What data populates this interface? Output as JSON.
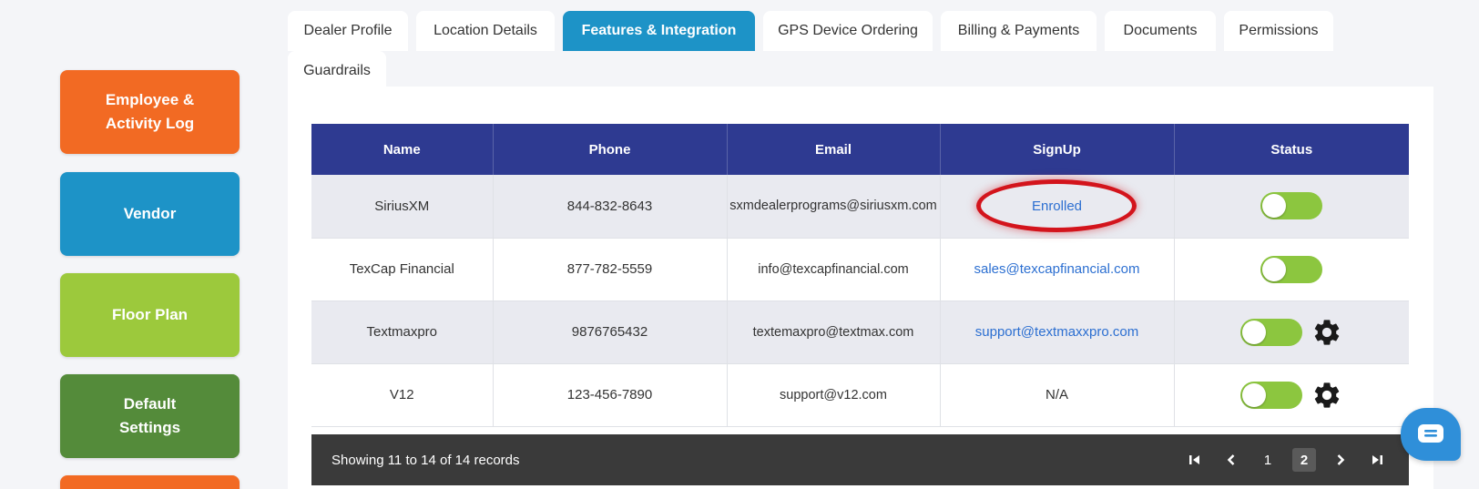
{
  "sidebar": {
    "items": [
      {
        "label": "Employee &\nActivity Log",
        "color": "#f26a23"
      },
      {
        "label": "Vendor",
        "color": "#1d93c7"
      },
      {
        "label": "Floor Plan",
        "color": "#9cc93c"
      },
      {
        "label": "Default\nSettings",
        "color": "#548b3a"
      },
      {
        "label": "",
        "color": "#f26a23"
      }
    ]
  },
  "tabs": [
    {
      "label": "Dealer Profile",
      "active": false
    },
    {
      "label": "Location Details",
      "active": false
    },
    {
      "label": "Features & Integration",
      "active": true
    },
    {
      "label": "GPS Device Ordering",
      "active": false
    },
    {
      "label": "Billing & Payments",
      "active": false
    },
    {
      "label": "Documents",
      "active": false
    },
    {
      "label": "Permissions",
      "active": false
    },
    {
      "label": "Guardrails",
      "active": false
    }
  ],
  "table": {
    "headers": [
      "Name",
      "Phone",
      "Email",
      "SignUp",
      "Status"
    ],
    "rows": [
      {
        "name": "SiriusXM",
        "phone": "844-832-8643",
        "email": "sxmdealerprograms@siriusxm.com",
        "signup": "Enrolled",
        "enabled": true,
        "gear": false
      },
      {
        "name": "TexCap Financial",
        "phone": "877-782-5559",
        "email": "info@texcapfinancial.com",
        "signup": "sales@texcapfinancial.com",
        "enabled": true,
        "gear": false
      },
      {
        "name": "Textmaxpro",
        "phone": "9876765432",
        "email": "textemaxpro@textmax.com",
        "signup": "support@textmaxxpro.com",
        "enabled": true,
        "gear": true
      },
      {
        "name": "V12",
        "phone": "123-456-7890",
        "email": "support@v12.com",
        "signup": "N/A",
        "enabled": true,
        "gear": true
      }
    ]
  },
  "footer": {
    "records_text": "Showing 11 to 14 of 14 records",
    "pages": [
      "1",
      "2"
    ],
    "current_page": "2"
  },
  "icons": {
    "first": "first-page-icon",
    "prev": "prev-page-icon",
    "next": "next-page-icon",
    "last": "last-page-icon",
    "gear": "gear-icon",
    "chat": "chat-icon"
  },
  "colors": {
    "header_bg": "#2e3a91",
    "active_tab": "#1d93c7",
    "toggle_on": "#8cc63f",
    "highlight_ring": "#d3141c"
  }
}
